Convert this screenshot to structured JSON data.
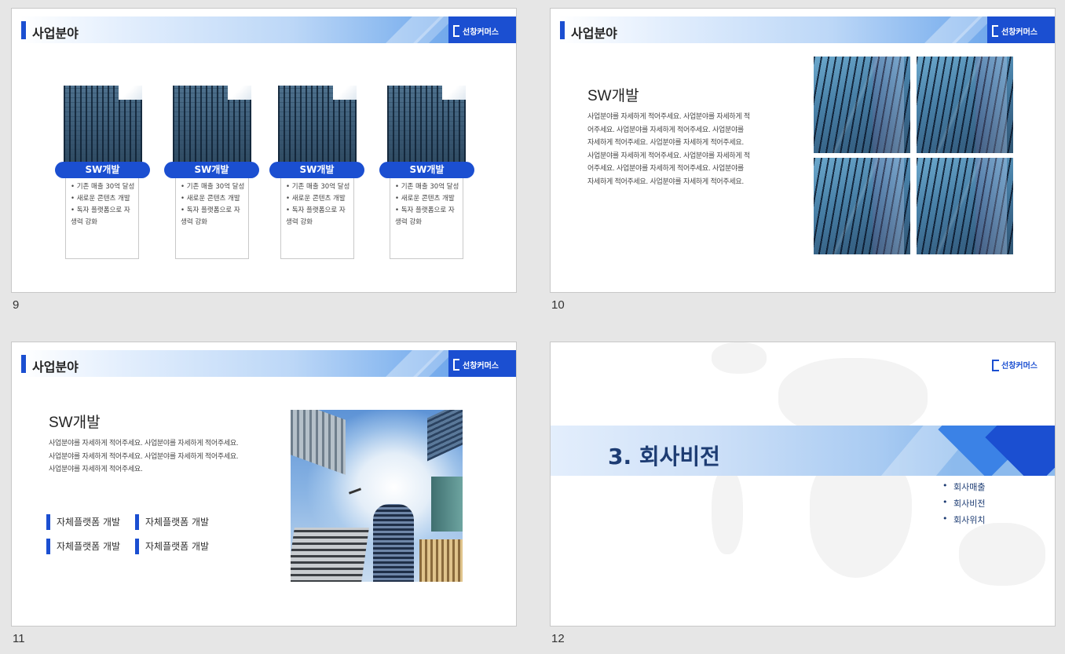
{
  "slides": [
    {
      "number": "9",
      "header": {
        "title": "사업분야",
        "logo": "선창커머스"
      },
      "cards": [
        {
          "label": "SW개발",
          "items": [
            "기존 매출 30억 달성",
            "새로운 콘텐츠 개발",
            "독자 플랫폼으로 자생력 강화"
          ]
        },
        {
          "label": "SW개발",
          "items": [
            "기존 매출 30억 달성",
            "새로운 콘텐츠 개발",
            "독자 플랫폼으로 자생력 강화"
          ]
        },
        {
          "label": "SW개발",
          "items": [
            "기존 매출 30억 달성",
            "새로운 콘텐츠 개발",
            "독자 플랫폼으로 자생력 강화"
          ]
        },
        {
          "label": "SW개발",
          "items": [
            "기존 매출 30억 달성",
            "새로운 콘텐츠 개발",
            "독자 플랫폼으로 자생력 강화"
          ]
        }
      ]
    },
    {
      "number": "10",
      "header": {
        "title": "사업분야",
        "logo": "선창커머스"
      },
      "heading": "SW개발",
      "lines": [
        "사업분야를 자세하게 적어주세요. 사업분야를 자세하게 적",
        "어주세요. 사업분야를 자세하게 적어주세요. 사업분야를",
        "자세하게 적어주세요. 사업분야를 자세하게 적어주세요.",
        "사업분야를 자세하게 적어주세요. 사업분야를 자세하게 적",
        "어주세요. 사업분야를 자세하게 적어주세요. 사업분야를",
        "자세하게 적어주세요. 사업분야를 자세하게 적어주세요."
      ]
    },
    {
      "number": "11",
      "header": {
        "title": "사업분야",
        "logo": "선창커머스"
      },
      "heading": "SW개발",
      "lines": [
        "사업분야를 자세하게 적어주세요. 사업분야를 자세하게 적어주세요.",
        "사업분야를 자세하게 적어주세요. 사업분야를 자세하게 적어주세요.",
        "사업분야를 자세하게 적어주세요."
      ],
      "features": [
        "자체플랫폼 개발",
        "자체플랫폼 개발",
        "자체플랫폼 개발",
        "자체플랫폼 개발"
      ]
    },
    {
      "number": "12",
      "logo": "선창커머스",
      "title": "3. 회사비전",
      "bullets": [
        "회사매출",
        "회사비전",
        "회사위치"
      ]
    }
  ],
  "colors": {
    "accent": "#1b4fd1",
    "title_navy": "#1d3c73",
    "background": "#e6e6e6"
  }
}
